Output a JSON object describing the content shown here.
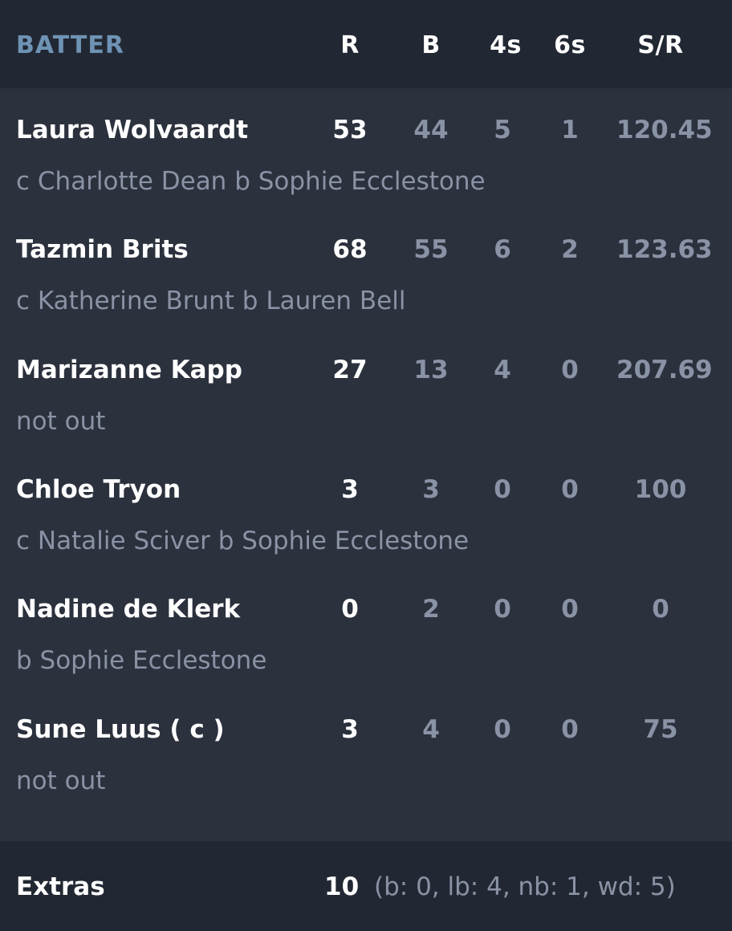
{
  "header": {
    "batter": "BATTER",
    "runs": "R",
    "balls": "B",
    "fours": "4s",
    "sixes": "6s",
    "strike_rate": "S/R"
  },
  "batters": [
    {
      "name": "Laura Wolvaardt",
      "dismissal": "c Charlotte Dean b Sophie Ecclestone",
      "runs": "53",
      "balls": "44",
      "fours": "5",
      "sixes": "1",
      "strike_rate": "120.45"
    },
    {
      "name": "Tazmin Brits",
      "dismissal": "c Katherine Brunt b Lauren Bell",
      "runs": "68",
      "balls": "55",
      "fours": "6",
      "sixes": "2",
      "strike_rate": "123.63"
    },
    {
      "name": "Marizanne Kapp",
      "dismissal": "not out",
      "runs": "27",
      "balls": "13",
      "fours": "4",
      "sixes": "0",
      "strike_rate": "207.69"
    },
    {
      "name": "Chloe Tryon",
      "dismissal": "c Natalie Sciver b Sophie Ecclestone",
      "runs": "3",
      "balls": "3",
      "fours": "0",
      "sixes": "0",
      "strike_rate": "100"
    },
    {
      "name": "Nadine de Klerk",
      "dismissal": "b Sophie Ecclestone",
      "runs": "0",
      "balls": "2",
      "fours": "0",
      "sixes": "0",
      "strike_rate": "0"
    },
    {
      "name": "Sune Luus ( c )",
      "dismissal": "not out",
      "runs": "3",
      "balls": "4",
      "fours": "0",
      "sixes": "0",
      "strike_rate": "75"
    }
  ],
  "extras": {
    "label": "Extras",
    "total": "10",
    "detail": "(b: 0, lb: 4, nb: 1, wd: 5)"
  },
  "colors": {
    "background": "#2b313d",
    "header_background": "#222833",
    "accent": "#6e93b4",
    "primary_text": "#ffffff",
    "secondary_text": "#8a93a5"
  }
}
